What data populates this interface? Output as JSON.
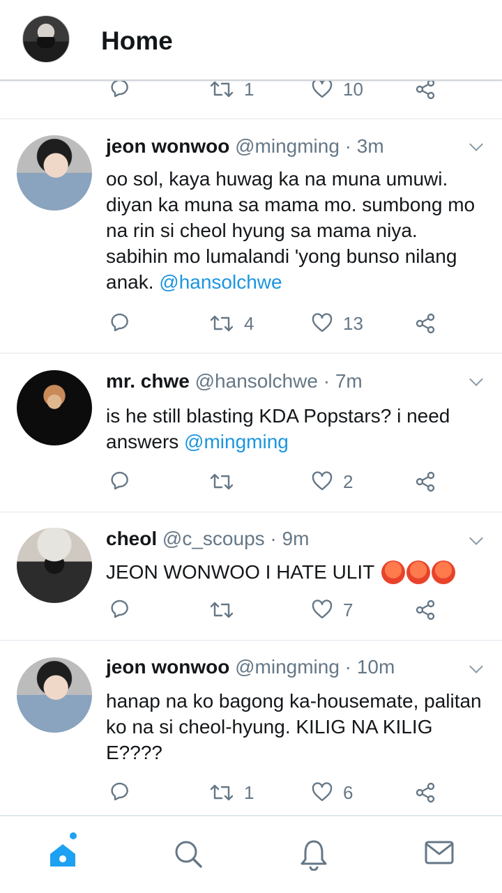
{
  "header": {
    "title": "Home"
  },
  "partial_tweet": {
    "retweets": "1",
    "likes": "10"
  },
  "tweets": [
    {
      "name": "jeon wonwoo",
      "handle": "@mingming",
      "time": "3m",
      "text": "oo sol, kaya huwag ka na muna umuwi. diyan ka muna sa mama mo. sumbong mo na rin si cheol hyung sa mama niya. sabihin mo lumalandi 'yong bunso nilang anak. ",
      "mention": "@hansolchwe",
      "retweets": "4",
      "likes": "13"
    },
    {
      "name": "mr. chwe",
      "handle": "@hansolchwe",
      "time": "7m",
      "text": "is he still blasting KDA Popstars? i need answers ",
      "mention": "@mingming",
      "retweets": "",
      "likes": "2"
    },
    {
      "name": "cheol",
      "handle": "@c_scoups",
      "time": "9m",
      "text": "JEON WONWOO I HATE ULIT",
      "emoji": [
        "angry-face",
        "angry-face",
        "angry-face"
      ],
      "retweets": "",
      "likes": "7"
    },
    {
      "name": "jeon wonwoo",
      "handle": "@mingming",
      "time": "10m",
      "text": "hanap na ko bagong ka-housemate, palitan ko na si cheol-hyung. KILIG NA KILIG E????",
      "retweets": "1",
      "likes": "6"
    }
  ],
  "colors": {
    "accent": "#1da1f2",
    "mention": "#1b95e0",
    "muted": "#657786",
    "divider": "#e1e8ed"
  },
  "bottom_nav": [
    "home-icon",
    "search-icon",
    "bell-icon",
    "mail-icon"
  ]
}
